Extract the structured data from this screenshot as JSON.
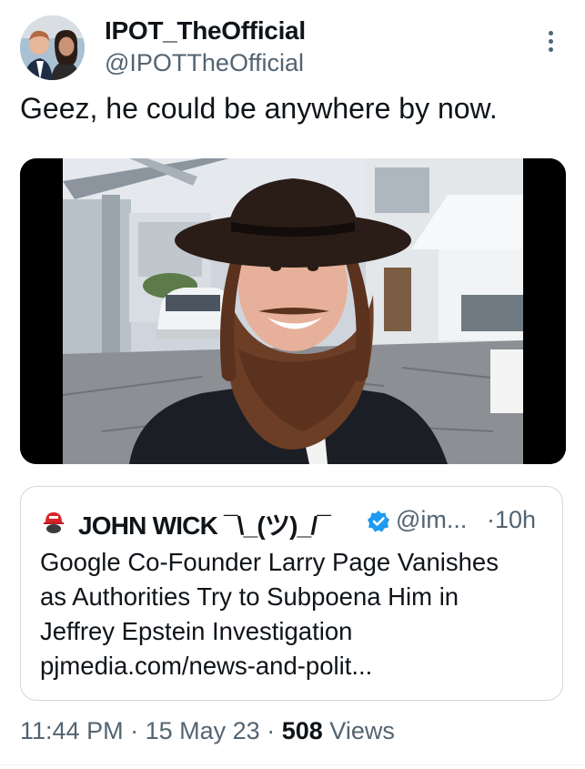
{
  "author": {
    "display_name": "IPOT_TheOfficial",
    "handle": "@IPOTTheOfficial"
  },
  "tweet": {
    "text": "Geez, he could be anywhere by now."
  },
  "quoted": {
    "display_name": "JOHN WICK ¯\\_(ツ)_/¯",
    "handle": "@im...",
    "separator": "·",
    "time": "10h",
    "lines": [
      "Google Co-Founder Larry Page Vanishes",
      "as Authorities Try to Subpoena Him in",
      "Jeffrey Epstein Investigation",
      "pjmedia.com/news-and-polit..."
    ]
  },
  "meta": {
    "time": "11:44 PM",
    "separator": "·",
    "date": "15 May 23",
    "views_count": "508",
    "views_label": "Views"
  },
  "icons": {
    "more": "more-vertical-icon",
    "verified": "verified-badge-icon",
    "quoted_avatar": "red-cap-avatar-icon"
  },
  "colors": {
    "text": "#0f1419",
    "secondary": "#536471",
    "verified": "#1d9bf0",
    "border": "#cfd9de"
  }
}
